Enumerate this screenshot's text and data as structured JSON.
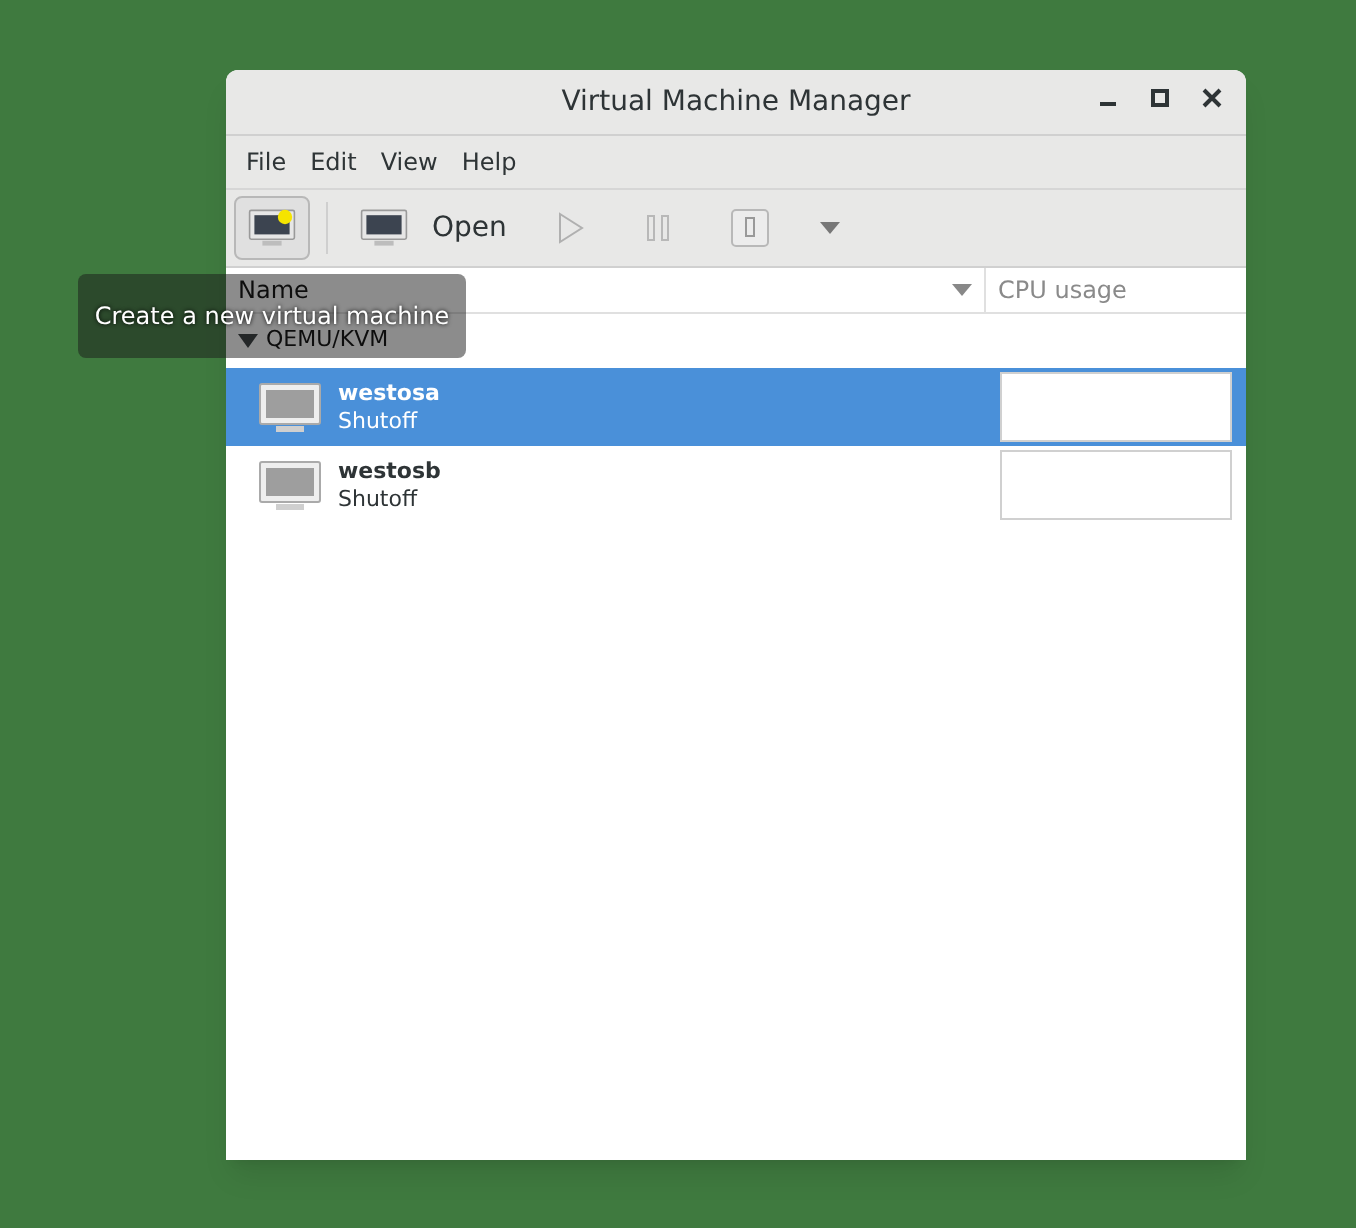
{
  "window": {
    "title": "Virtual Machine Manager"
  },
  "menu": [
    "File",
    "Edit",
    "View",
    "Help"
  ],
  "toolbar": {
    "open_label": "Open"
  },
  "tooltip": "Create a new virtual machine",
  "table": {
    "columns": [
      "Name",
      "CPU usage"
    ],
    "group": {
      "label": "QEMU/KVM",
      "expanded": true
    },
    "rows": [
      {
        "name": "westosa",
        "status": "Shutoff",
        "selected": true
      },
      {
        "name": "westosb",
        "status": "Shutoff",
        "selected": false
      }
    ]
  }
}
